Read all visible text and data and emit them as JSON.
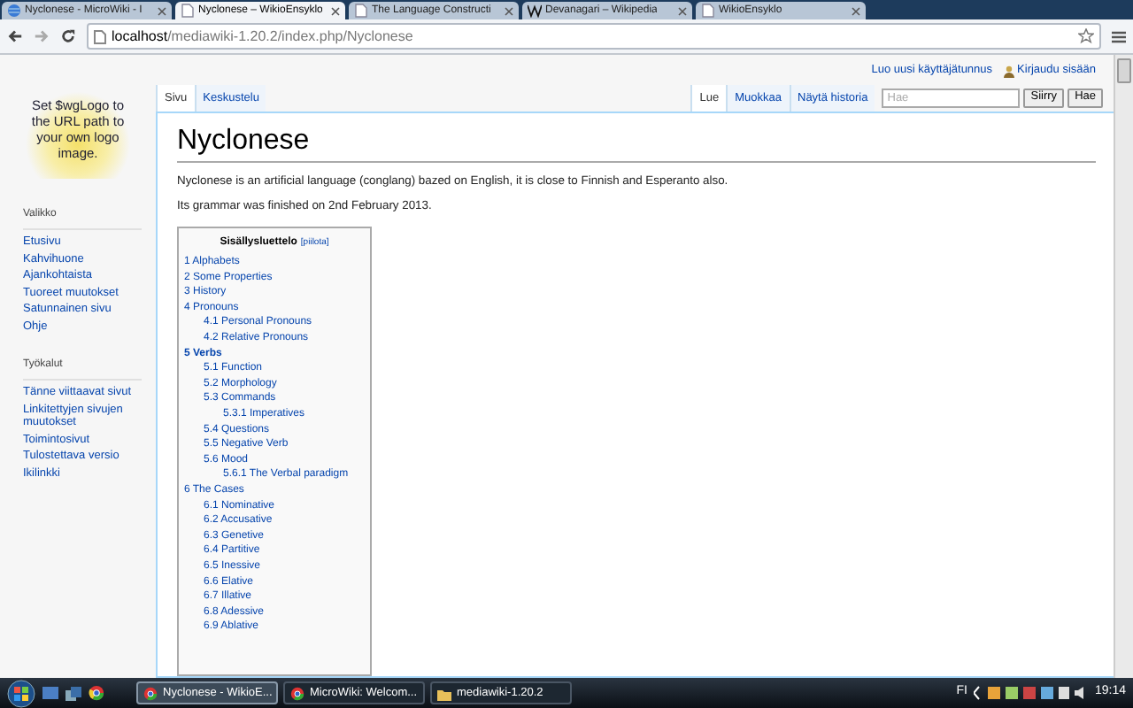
{
  "browser": {
    "tabs": [
      {
        "title": "Nyclonese - MicroWiki - I",
        "kind": "globe",
        "selected": false
      },
      {
        "title": "Nyclonese – WikioEnsyklo",
        "kind": "page",
        "selected": true
      },
      {
        "title": "The Language Constructi",
        "kind": "page",
        "selected": false
      },
      {
        "title": "Devanagari – Wikipedia",
        "kind": "w",
        "selected": false
      },
      {
        "title": "WikioEnsyklo",
        "kind": "page",
        "selected": false
      }
    ],
    "url_host": "localhost",
    "url_path": "/mediawiki-1.20.2/index.php/Nyclonese"
  },
  "personal": [
    "Luo uusi käyttäjätunnus",
    "Kirjaudu sisään"
  ],
  "logo_text": "Set $wgLogo to the URL path to your own logo image.",
  "sidebar": [
    {
      "heading": "Valikko",
      "items": [
        "Etusivu",
        "Kahvihuone",
        "Ajankohtaista",
        "Tuoreet muutokset",
        "Satunnainen sivu",
        "Ohje"
      ]
    },
    {
      "heading": "Työkalut",
      "items": [
        "Tänne viittaavat sivut",
        "Linkitettyjen sivujen muutokset",
        "Toimintosivut",
        "Tulostettava versio",
        "Ikilinkki"
      ]
    }
  ],
  "page_tabs": [
    {
      "label": "Sivu",
      "selected": true
    },
    {
      "label": "Keskustelu",
      "selected": false
    }
  ],
  "view_tabs": [
    {
      "label": "Lue",
      "selected": true
    },
    {
      "label": "Muokkaa",
      "selected": false
    },
    {
      "label": "Näytä historia",
      "selected": false
    }
  ],
  "search": {
    "placeholder": "Hae",
    "buttons": [
      "Siirry",
      "Hae"
    ]
  },
  "title": "Nyclonese",
  "paragraphs": [
    "Nyclonese is an artificial language (conglang) bazed on English, it is close to Finnish and Esperanto also.",
    "Its grammar was finished on 2nd February 2013."
  ],
  "toc": {
    "title": "Sisällysluettelo",
    "toggle": "[piilota]",
    "items": [
      {
        "label": "1 Alphabets",
        "current": false
      },
      {
        "label": "2 Some Properties",
        "current": false
      },
      {
        "label": "3 History",
        "current": false
      },
      {
        "label": "4 Pronouns",
        "current": false,
        "children": [
          {
            "label": "4.1 Personal Pronouns",
            "current": false
          },
          {
            "label": "4.2 Relative Pronouns",
            "current": false
          }
        ]
      },
      {
        "label": "5 Verbs",
        "current": true,
        "children": [
          {
            "label": "5.1 Function",
            "current": false
          },
          {
            "label": "5.2 Morphology",
            "current": false
          },
          {
            "label": "5.3 Commands",
            "current": false,
            "children": [
              {
                "label": "5.3.1 Imperatives",
                "current": false
              }
            ]
          },
          {
            "label": "5.4 Questions",
            "current": false
          },
          {
            "label": "5.5 Negative Verb",
            "current": false
          },
          {
            "label": "5.6 Mood",
            "current": false,
            "children": [
              {
                "label": "5.6.1 The Verbal paradigm",
                "current": false
              }
            ]
          }
        ]
      },
      {
        "label": "6 The Cases",
        "current": false,
        "children": [
          {
            "label": "6.1 Nominative",
            "current": false
          },
          {
            "label": "6.2 Accusative",
            "current": false
          },
          {
            "label": "6.3 Genetive",
            "current": false
          },
          {
            "label": "6.4 Partitive",
            "current": false
          },
          {
            "label": "6.5 Inessive",
            "current": false
          },
          {
            "label": "6.6 Elative",
            "current": false
          },
          {
            "label": "6.7 Illative",
            "current": false
          },
          {
            "label": "6.8 Adessive",
            "current": false
          },
          {
            "label": "6.9 Ablative",
            "current": false
          }
        ]
      }
    ]
  },
  "taskbar": {
    "buttons": [
      {
        "label": "Nyclonese - WikioE...",
        "kind": "chrome",
        "selected": true
      },
      {
        "label": "MicroWiki: Welcom...",
        "kind": "chrome",
        "selected": false
      },
      {
        "label": "mediawiki-1.20.2",
        "kind": "folder",
        "selected": false
      }
    ],
    "language": "FI",
    "clock": "19:14"
  }
}
